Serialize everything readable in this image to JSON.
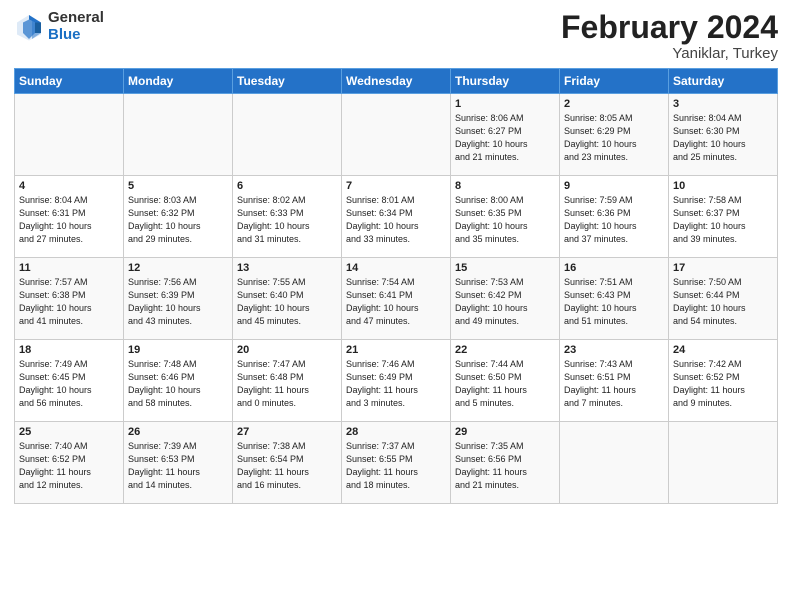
{
  "header": {
    "logo_general": "General",
    "logo_blue": "Blue",
    "title": "February 2024",
    "subtitle": "Yaniklar, Turkey"
  },
  "days_of_week": [
    "Sunday",
    "Monday",
    "Tuesday",
    "Wednesday",
    "Thursday",
    "Friday",
    "Saturday"
  ],
  "weeks": [
    [
      {
        "day": "",
        "info": ""
      },
      {
        "day": "",
        "info": ""
      },
      {
        "day": "",
        "info": ""
      },
      {
        "day": "",
        "info": ""
      },
      {
        "day": "1",
        "info": "Sunrise: 8:06 AM\nSunset: 6:27 PM\nDaylight: 10 hours\nand 21 minutes."
      },
      {
        "day": "2",
        "info": "Sunrise: 8:05 AM\nSunset: 6:29 PM\nDaylight: 10 hours\nand 23 minutes."
      },
      {
        "day": "3",
        "info": "Sunrise: 8:04 AM\nSunset: 6:30 PM\nDaylight: 10 hours\nand 25 minutes."
      }
    ],
    [
      {
        "day": "4",
        "info": "Sunrise: 8:04 AM\nSunset: 6:31 PM\nDaylight: 10 hours\nand 27 minutes."
      },
      {
        "day": "5",
        "info": "Sunrise: 8:03 AM\nSunset: 6:32 PM\nDaylight: 10 hours\nand 29 minutes."
      },
      {
        "day": "6",
        "info": "Sunrise: 8:02 AM\nSunset: 6:33 PM\nDaylight: 10 hours\nand 31 minutes."
      },
      {
        "day": "7",
        "info": "Sunrise: 8:01 AM\nSunset: 6:34 PM\nDaylight: 10 hours\nand 33 minutes."
      },
      {
        "day": "8",
        "info": "Sunrise: 8:00 AM\nSunset: 6:35 PM\nDaylight: 10 hours\nand 35 minutes."
      },
      {
        "day": "9",
        "info": "Sunrise: 7:59 AM\nSunset: 6:36 PM\nDaylight: 10 hours\nand 37 minutes."
      },
      {
        "day": "10",
        "info": "Sunrise: 7:58 AM\nSunset: 6:37 PM\nDaylight: 10 hours\nand 39 minutes."
      }
    ],
    [
      {
        "day": "11",
        "info": "Sunrise: 7:57 AM\nSunset: 6:38 PM\nDaylight: 10 hours\nand 41 minutes."
      },
      {
        "day": "12",
        "info": "Sunrise: 7:56 AM\nSunset: 6:39 PM\nDaylight: 10 hours\nand 43 minutes."
      },
      {
        "day": "13",
        "info": "Sunrise: 7:55 AM\nSunset: 6:40 PM\nDaylight: 10 hours\nand 45 minutes."
      },
      {
        "day": "14",
        "info": "Sunrise: 7:54 AM\nSunset: 6:41 PM\nDaylight: 10 hours\nand 47 minutes."
      },
      {
        "day": "15",
        "info": "Sunrise: 7:53 AM\nSunset: 6:42 PM\nDaylight: 10 hours\nand 49 minutes."
      },
      {
        "day": "16",
        "info": "Sunrise: 7:51 AM\nSunset: 6:43 PM\nDaylight: 10 hours\nand 51 minutes."
      },
      {
        "day": "17",
        "info": "Sunrise: 7:50 AM\nSunset: 6:44 PM\nDaylight: 10 hours\nand 54 minutes."
      }
    ],
    [
      {
        "day": "18",
        "info": "Sunrise: 7:49 AM\nSunset: 6:45 PM\nDaylight: 10 hours\nand 56 minutes."
      },
      {
        "day": "19",
        "info": "Sunrise: 7:48 AM\nSunset: 6:46 PM\nDaylight: 10 hours\nand 58 minutes."
      },
      {
        "day": "20",
        "info": "Sunrise: 7:47 AM\nSunset: 6:48 PM\nDaylight: 11 hours\nand 0 minutes."
      },
      {
        "day": "21",
        "info": "Sunrise: 7:46 AM\nSunset: 6:49 PM\nDaylight: 11 hours\nand 3 minutes."
      },
      {
        "day": "22",
        "info": "Sunrise: 7:44 AM\nSunset: 6:50 PM\nDaylight: 11 hours\nand 5 minutes."
      },
      {
        "day": "23",
        "info": "Sunrise: 7:43 AM\nSunset: 6:51 PM\nDaylight: 11 hours\nand 7 minutes."
      },
      {
        "day": "24",
        "info": "Sunrise: 7:42 AM\nSunset: 6:52 PM\nDaylight: 11 hours\nand 9 minutes."
      }
    ],
    [
      {
        "day": "25",
        "info": "Sunrise: 7:40 AM\nSunset: 6:52 PM\nDaylight: 11 hours\nand 12 minutes."
      },
      {
        "day": "26",
        "info": "Sunrise: 7:39 AM\nSunset: 6:53 PM\nDaylight: 11 hours\nand 14 minutes."
      },
      {
        "day": "27",
        "info": "Sunrise: 7:38 AM\nSunset: 6:54 PM\nDaylight: 11 hours\nand 16 minutes."
      },
      {
        "day": "28",
        "info": "Sunrise: 7:37 AM\nSunset: 6:55 PM\nDaylight: 11 hours\nand 18 minutes."
      },
      {
        "day": "29",
        "info": "Sunrise: 7:35 AM\nSunset: 6:56 PM\nDaylight: 11 hours\nand 21 minutes."
      },
      {
        "day": "",
        "info": ""
      },
      {
        "day": "",
        "info": ""
      }
    ]
  ]
}
